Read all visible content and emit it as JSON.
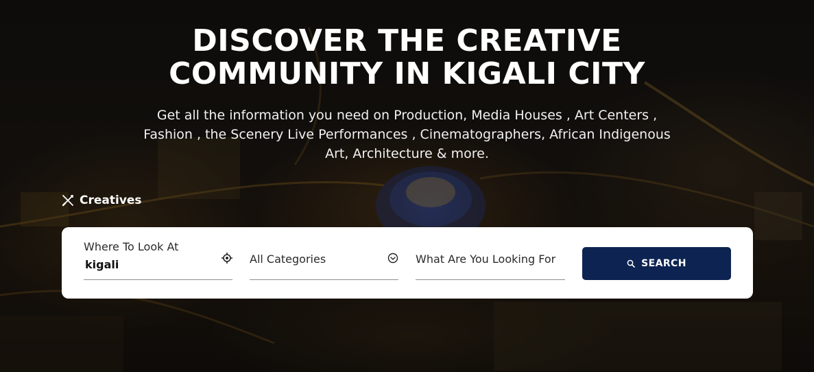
{
  "hero": {
    "headline_line1": "DISCOVER THE CREATIVE",
    "headline_line2": "COMMUNITY IN KIGALI CITY",
    "subtitle": "Get all the information you need on Production, Media Houses , Art Centers , Fashion , the Scenery Live Performances , Cinematographers, African Indigenous Art, Architecture & more.",
    "background_image": "aerial night view of Kigali city"
  },
  "tab": {
    "label": "Creatives",
    "icon": "crossed-tools-icon"
  },
  "search_form": {
    "location": {
      "label": "Where To Look At",
      "value": "kigali",
      "icon": "locate-crosshair-icon"
    },
    "category": {
      "selected": "All Categories",
      "icon": "chevron-down-circle-icon"
    },
    "keyword": {
      "placeholder": "What Are You Looking For"
    },
    "search_button": {
      "label": "SEARCH",
      "icon": "search-icon"
    }
  },
  "colors": {
    "button_background": "#0d2452",
    "card_background": "#ffffff",
    "text_white": "#ffffff"
  }
}
